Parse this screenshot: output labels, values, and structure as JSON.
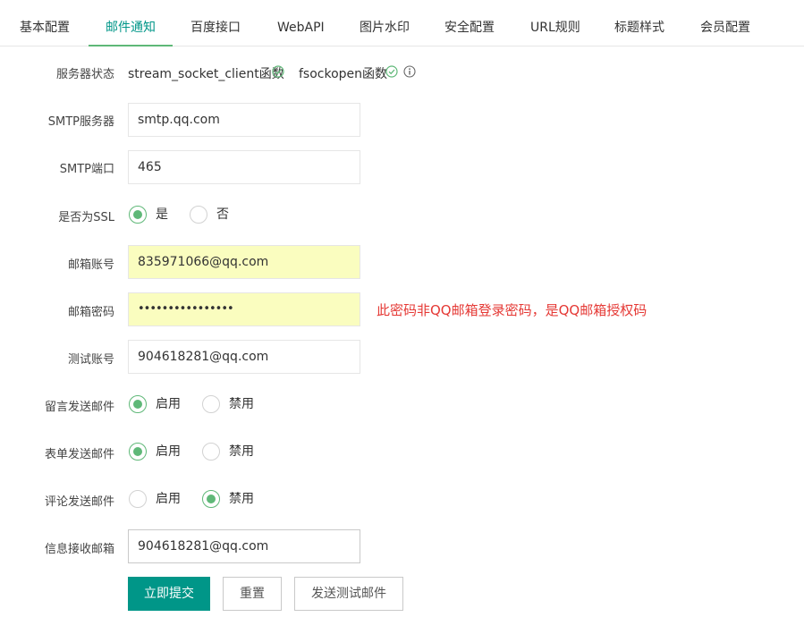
{
  "tabs": [
    "基本配置",
    "邮件通知",
    "百度接口",
    "WebAPI",
    "图片水印",
    "安全配置",
    "URL规则",
    "标题样式",
    "会员配置"
  ],
  "active_tab": "邮件通知",
  "server_status": {
    "label": "服务器状态",
    "item1": "stream_socket_client函数",
    "item2": "fsockopen函数"
  },
  "smtp_server": {
    "label": "SMTP服务器",
    "value": "smtp.qq.com"
  },
  "smtp_port": {
    "label": "SMTP端口",
    "value": "465"
  },
  "ssl": {
    "label": "是否为SSL",
    "options": [
      "是",
      "否"
    ],
    "selected": "是"
  },
  "mail_account": {
    "label": "邮箱账号",
    "value": "835971066@qq.com"
  },
  "mail_password": {
    "label": "邮箱密码",
    "value": "••••••••••••••••",
    "hint": "此密码非QQ邮箱登录密码，是QQ邮箱授权码"
  },
  "test_account": {
    "label": "测试账号",
    "value": "904618281@qq.com"
  },
  "message_mail": {
    "label": "留言发送邮件",
    "options": [
      "启用",
      "禁用"
    ],
    "selected": "启用"
  },
  "form_mail": {
    "label": "表单发送邮件",
    "options": [
      "启用",
      "禁用"
    ],
    "selected": "启用"
  },
  "comment_mail": {
    "label": "评论发送邮件",
    "options": [
      "启用",
      "禁用"
    ],
    "selected": "禁用"
  },
  "receive_mail": {
    "label": "信息接收邮箱",
    "value": "904618281@qq.com"
  },
  "buttons": {
    "submit": "立即提交",
    "reset": "重置",
    "send_test": "发送测试邮件"
  },
  "colors": {
    "accent": "#009688",
    "radio": "#5FB878",
    "hint": "#e53935",
    "autofill": "#fafdbf"
  }
}
